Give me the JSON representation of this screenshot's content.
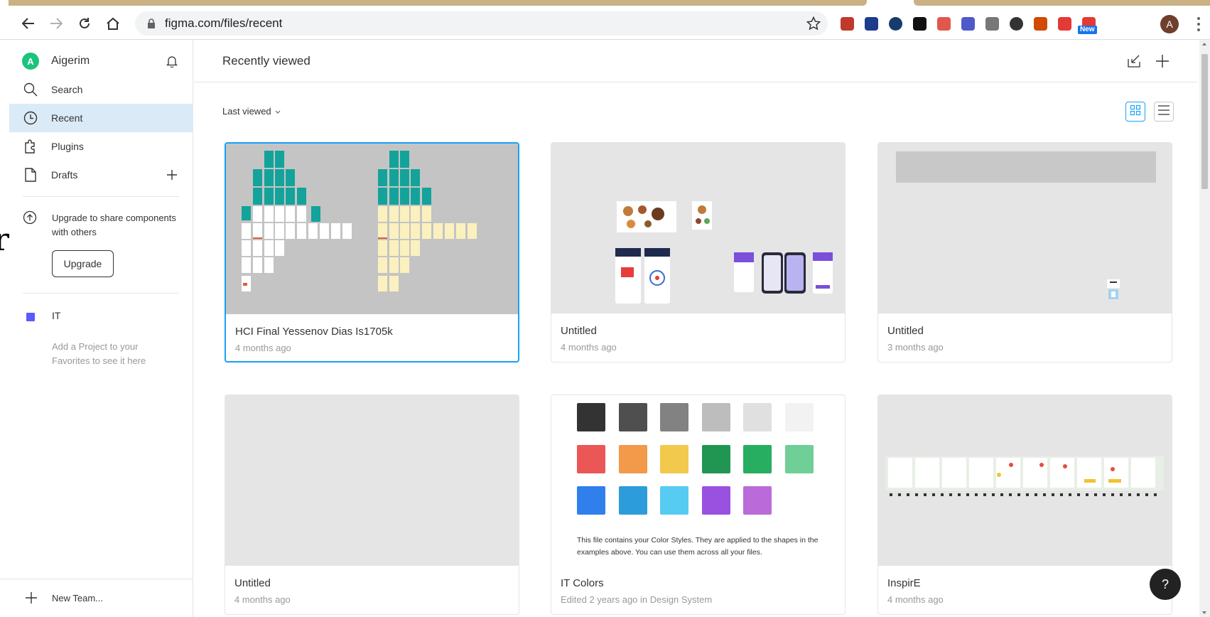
{
  "browser": {
    "url": "figma.com/files/recent",
    "new_badge": "New",
    "profile_initial": "A",
    "extensions": [
      {
        "name": "pdf-extension-icon",
        "color": "#c0392b"
      },
      {
        "name": "screen-cast-extension-icon",
        "color": "#1e3c8c"
      },
      {
        "name": "circle-extension-icon",
        "color": "#173b6c"
      },
      {
        "name": "camera-extension-icon",
        "color": "#111111"
      },
      {
        "name": "network-extension-icon",
        "color": "#e2574c"
      },
      {
        "name": "teams-extension-icon",
        "color": "#5059c9"
      },
      {
        "name": "shield-grey-extension-icon",
        "color": "#777777"
      },
      {
        "name": "eye-extension-icon",
        "color": "#333333"
      },
      {
        "name": "office-extension-icon",
        "color": "#d04a02"
      },
      {
        "name": "shield-red-extension-icon",
        "color": "#e53935"
      },
      {
        "name": "headset-extension-icon",
        "color": "#e53935"
      }
    ]
  },
  "sidebar": {
    "user": {
      "initial": "A",
      "name": "Aigerim"
    },
    "nav": [
      {
        "name": "search",
        "label": "Search"
      },
      {
        "name": "recent",
        "label": "Recent"
      },
      {
        "name": "plugins",
        "label": "Plugins"
      },
      {
        "name": "drafts",
        "label": "Drafts"
      }
    ],
    "upgrade_text": "Upgrade to share components with others",
    "upgrade_button": "Upgrade",
    "team": {
      "label": "IT",
      "color": "#5a5aff"
    },
    "favorites_hint": "Add a Project to your Favorites to see it here",
    "new_team": "New Team..."
  },
  "main": {
    "title": "Recently viewed",
    "sort_label": "Last viewed",
    "files": [
      {
        "title": "HCI Final Yessenov Dias Is1705k",
        "subtitle": "4 months ago"
      },
      {
        "title": "Untitled",
        "subtitle": "4 months ago"
      },
      {
        "title": "Untitled",
        "subtitle": "3 months ago"
      },
      {
        "title": "Untitled",
        "subtitle": "4 months ago"
      },
      {
        "title": "IT Colors",
        "subtitle": "Edited 2 years ago in Design System"
      },
      {
        "title": "InspirE",
        "subtitle": "4 months ago"
      }
    ],
    "color_note": "This file contains your Color Styles. They are applied to the shapes in the examples above. You can use them across all your files.",
    "swatch_colors": [
      [
        "#333333",
        "#4f4f4f",
        "#828282",
        "#bdbdbd",
        "#e0e0e0",
        "#f2f2f2"
      ],
      [
        "#eb5757",
        "#f2994a",
        "#f2c94c",
        "#219653",
        "#27ae60",
        "#6fcf97"
      ],
      [
        "#2f80ed",
        "#2d9cdb",
        "#56ccf2",
        "#9b51e0",
        "#bb6bd9"
      ]
    ],
    "help_label": "?"
  },
  "colors": {
    "accent": "#18a0fb",
    "active_nav_bg": "#daebf7",
    "avatar_green": "#1bc47d"
  }
}
